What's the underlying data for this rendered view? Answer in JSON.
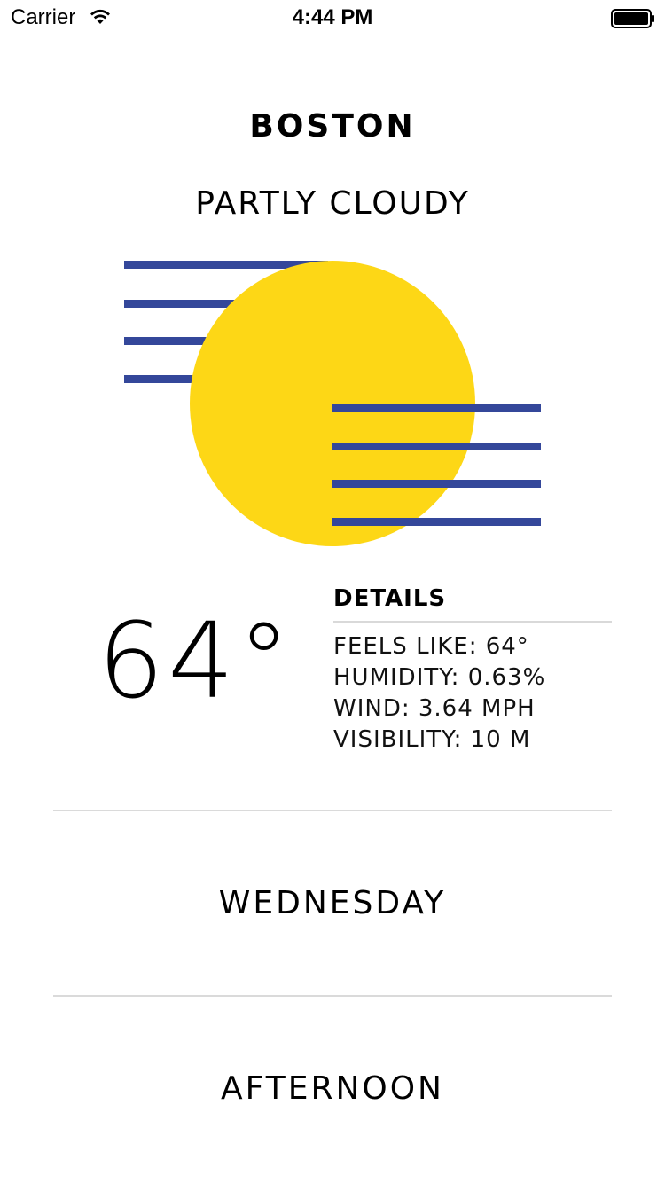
{
  "status_bar": {
    "carrier": "Carrier",
    "time": "4:44 PM",
    "wifi_icon": "wifi-icon",
    "battery_icon": "battery-icon"
  },
  "weather": {
    "city": "BOSTON",
    "condition": "PARTLY CLOUDY",
    "illustration": "partly-cloudy-icon",
    "sun_color": "#FDD716",
    "cloud_line_color": "#34479A",
    "temperature": "64°"
  },
  "details": {
    "title": "DETAILS",
    "rows": [
      "FEELS LIKE: 64°",
      "HUMIDITY: 0.63%",
      "WIND: 3.64 MPH",
      "VISIBILITY: 10 M"
    ]
  },
  "day": "WEDNESDAY",
  "time_of_day": "AFTERNOON"
}
